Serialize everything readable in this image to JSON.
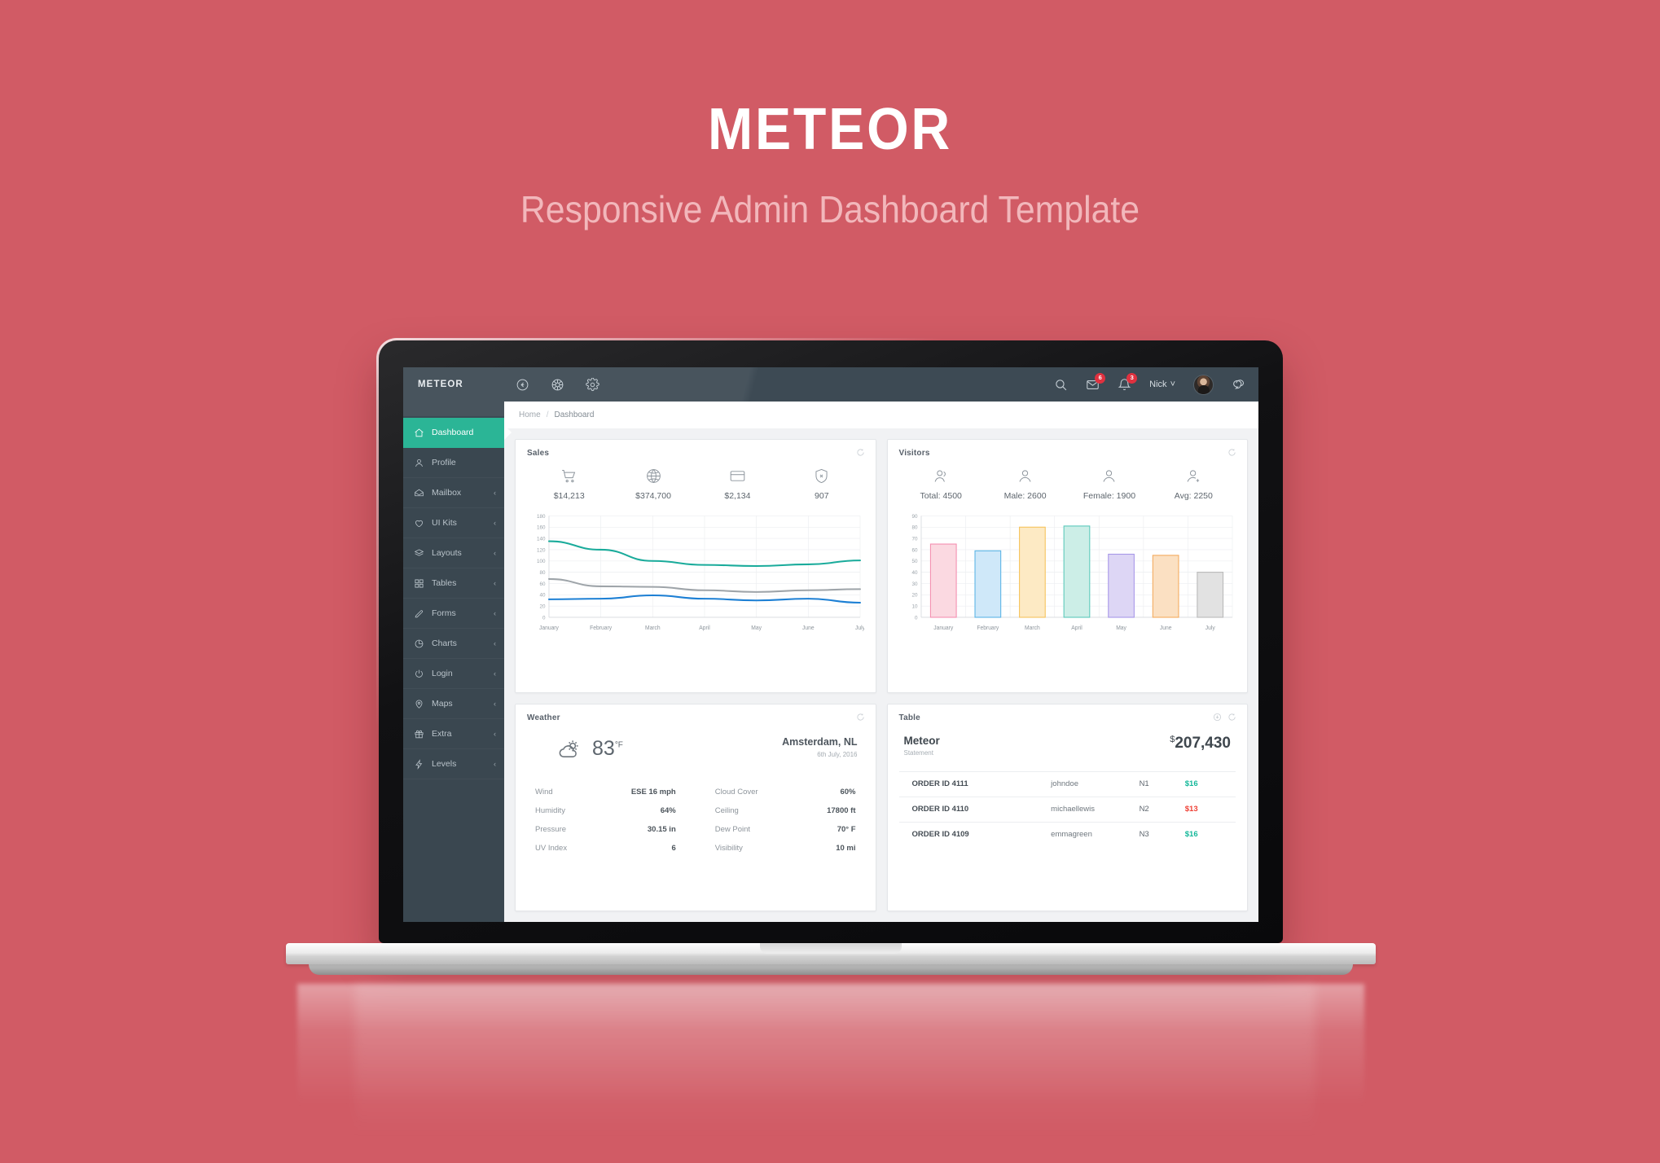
{
  "hero": {
    "title": "METEOR",
    "subtitle": "Responsive Admin Dashboard Template"
  },
  "colors": {
    "background": "#d15b65",
    "navbar": "#3d4a54",
    "sidebar": "#3a4750",
    "accent_teal": "#2bb596",
    "badge_red": "#e0313f",
    "up_green": "#14b89a",
    "down_red": "#ef4136"
  },
  "navbar": {
    "brand": "METEOR",
    "icons": [
      "back-circle-icon",
      "color-wheel-icon",
      "gear-icon"
    ],
    "search_icon": "search-icon",
    "mail_badge": "6",
    "bell_badge": "3",
    "user_name": "Nick",
    "caret": "˅",
    "chat_icon": "chat-bubble-icon"
  },
  "breadcrumb": {
    "home": "Home",
    "separator": "/",
    "current": "Dashboard"
  },
  "sidebar": {
    "items": [
      {
        "label": "Dashboard",
        "icon": "home-icon",
        "active": true,
        "caret": ""
      },
      {
        "label": "Profile",
        "icon": "user-icon",
        "active": false,
        "caret": ""
      },
      {
        "label": "Mailbox",
        "icon": "envelope-icon",
        "active": false,
        "caret": "‹"
      },
      {
        "label": "UI Kits",
        "icon": "heart-icon",
        "active": false,
        "caret": "‹"
      },
      {
        "label": "Layouts",
        "icon": "layers-icon",
        "active": false,
        "caret": "‹"
      },
      {
        "label": "Tables",
        "icon": "grid-icon",
        "active": false,
        "caret": "‹"
      },
      {
        "label": "Forms",
        "icon": "pencil-icon",
        "active": false,
        "caret": "‹"
      },
      {
        "label": "Charts",
        "icon": "pie-chart-icon",
        "active": false,
        "caret": "‹"
      },
      {
        "label": "Login",
        "icon": "power-icon",
        "active": false,
        "caret": "‹"
      },
      {
        "label": "Maps",
        "icon": "map-pin-icon",
        "active": false,
        "caret": "‹"
      },
      {
        "label": "Extra",
        "icon": "gift-icon",
        "active": false,
        "caret": "‹"
      },
      {
        "label": "Levels",
        "icon": "bolt-icon",
        "active": false,
        "caret": "‹"
      }
    ]
  },
  "sales_card": {
    "title": "Sales",
    "refresh_icon": "refresh-icon",
    "stats": [
      {
        "icon": "cart-icon",
        "value": "$14,213"
      },
      {
        "icon": "globe-icon",
        "value": "$374,700"
      },
      {
        "icon": "credit-card-icon",
        "value": "$2,134"
      },
      {
        "icon": "shield-icon",
        "value": "907"
      }
    ]
  },
  "visitors_card": {
    "title": "Visitors",
    "refresh_icon": "refresh-icon",
    "stats": [
      {
        "icon": "user-group-icon",
        "value": "Total: 4500"
      },
      {
        "icon": "user-male-icon",
        "value": "Male: 2600"
      },
      {
        "icon": "user-female-icon",
        "value": "Female: 1900"
      },
      {
        "icon": "user-add-icon",
        "value": "Avg: 2250"
      }
    ]
  },
  "weather_card": {
    "title": "Weather",
    "refresh_icon": "refresh-icon",
    "condition_icon": "partly-cloudy-icon",
    "temperature": "83",
    "temp_unit": "°F",
    "city": "Amsterdam, NL",
    "date": "6th July, 2016",
    "left_rows": [
      {
        "key": "Wind",
        "value": "ESE 16 mph"
      },
      {
        "key": "Humidity",
        "value": "64%"
      },
      {
        "key": "Pressure",
        "value": "30.15 in"
      },
      {
        "key": "UV Index",
        "value": "6"
      }
    ],
    "right_rows": [
      {
        "key": "Cloud Cover",
        "value": "60%"
      },
      {
        "key": "Ceiling",
        "value": "17800 ft"
      },
      {
        "key": "Dew Point",
        "value": "70° F"
      },
      {
        "key": "Visibility",
        "value": "10 mi"
      }
    ]
  },
  "table_card": {
    "title": "Table",
    "download_icon": "download-circle-icon",
    "refresh_icon": "refresh-icon",
    "account_name": "Meteor",
    "account_sub": "Statement",
    "currency": "$",
    "amount": "207,430",
    "rows": [
      {
        "order": "ORDER ID 4111",
        "user": "johndoe",
        "code": "N1",
        "amount": "$16",
        "dir": "up"
      },
      {
        "order": "ORDER ID 4110",
        "user": "michaellewis",
        "code": "N2",
        "amount": "$13",
        "dir": "down"
      },
      {
        "order": "ORDER ID 4109",
        "user": "emmagreen",
        "code": "N3",
        "amount": "$16",
        "dir": "up"
      }
    ]
  },
  "chart_data": [
    {
      "type": "line",
      "title": "Sales",
      "categories": [
        "January",
        "February",
        "March",
        "April",
        "May",
        "June",
        "July"
      ],
      "series": [
        {
          "name": "teal",
          "color": "#1aab9b",
          "values": [
            135,
            120,
            100,
            93,
            91,
            94,
            101
          ]
        },
        {
          "name": "gray",
          "color": "#9ea4a9",
          "values": [
            68,
            55,
            54,
            48,
            45,
            48,
            50
          ]
        },
        {
          "name": "blue",
          "color": "#1c7fd4",
          "values": [
            32,
            33,
            39,
            33,
            30,
            33,
            26
          ]
        }
      ],
      "ylim": [
        0,
        180
      ],
      "yticks": [
        0,
        20,
        40,
        60,
        80,
        100,
        120,
        140,
        160,
        180
      ],
      "xlabel": "",
      "ylabel": "",
      "grid": true,
      "legend": "none"
    },
    {
      "type": "bar",
      "title": "Visitors",
      "categories": [
        "January",
        "February",
        "March",
        "April",
        "May",
        "June",
        "July"
      ],
      "values": [
        65,
        59,
        80,
        81,
        56,
        55,
        40
      ],
      "bar_fills": [
        "#fbd9e1",
        "#cfe8f9",
        "#fdeac4",
        "#cceee7",
        "#ddd6f5",
        "#fbe0c2",
        "#e2e2e2"
      ],
      "bar_strokes": [
        "#f48fb1",
        "#5bb4e5",
        "#f6c35c",
        "#5cc9bb",
        "#a898e8",
        "#f4ab5e",
        "#b9b9b9"
      ],
      "ylim": [
        0,
        90
      ],
      "yticks": [
        0,
        10,
        20,
        30,
        40,
        50,
        60,
        70,
        80,
        90
      ],
      "xlabel": "",
      "ylabel": "",
      "grid": true,
      "legend": "none"
    }
  ]
}
